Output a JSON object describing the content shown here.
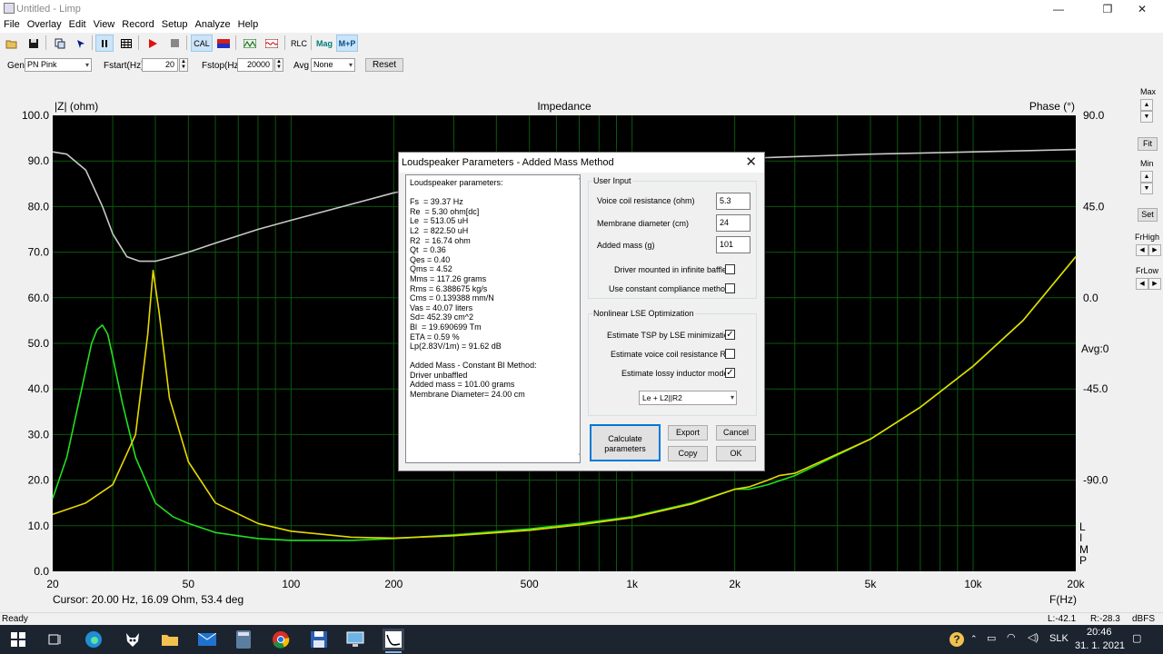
{
  "window": {
    "title": "Untitled - Limp",
    "controls": [
      "—",
      "❐",
      "✕"
    ]
  },
  "menu": [
    "File",
    "Overlay",
    "Edit",
    "View",
    "Record",
    "Setup",
    "Analyze",
    "Help"
  ],
  "toolbar": {
    "cal_label": "CAL",
    "rlc_label": "RLC",
    "mag_label": "Mag",
    "mp_label": "M+P"
  },
  "genbar": {
    "gen_label": "Gen",
    "gen_value": "PN Pink",
    "fstart_label": "Fstart(Hz)",
    "fstart_value": "20",
    "fstop_label": "Fstop(Hz)",
    "fstop_value": "20000",
    "avg_label": "Avg",
    "avg_value": "None",
    "reset_label": "Reset"
  },
  "plot": {
    "title": "Impedance",
    "y_left_label": "|Z| (ohm)",
    "y_right_label": "Phase (°)",
    "x_label": "F(Hz)",
    "cursor_text": "Cursor: 20.00 Hz, 16.09 Ohm, 53.4 deg",
    "avg_text": "Avg:0",
    "limp_letters": [
      "L",
      "I",
      "M",
      "P"
    ]
  },
  "chart_data": {
    "type": "line",
    "title": "Impedance",
    "xlabel": "F(Hz)",
    "ylabel": "|Z| (ohm)",
    "y2label": "Phase (°)",
    "xscale": "log",
    "xlim": [
      20,
      20000
    ],
    "ylim": [
      0,
      100
    ],
    "y2lim": [
      -135,
      90
    ],
    "x_ticks": [
      "20",
      "50",
      "100",
      "200",
      "500",
      "1k",
      "2k",
      "5k",
      "10k",
      "20k"
    ],
    "y_ticks": [
      "100.0",
      "90.0",
      "80.0",
      "70.0",
      "60.0",
      "50.0",
      "40.0",
      "30.0",
      "20.0",
      "10.0",
      "0.0"
    ],
    "y2_ticks": [
      "90.0",
      "45.0",
      "0.0",
      "-45.0",
      "-90.0"
    ],
    "grid": true,
    "background": "#000000",
    "series": [
      {
        "color": "#22e01e",
        "x": [
          20,
          22,
          24,
          26,
          27,
          28,
          29,
          30,
          32,
          35,
          40,
          45,
          50,
          60,
          80,
          100,
          150,
          200,
          300,
          500,
          700,
          1000,
          1500,
          2000,
          2200,
          2500,
          3000,
          5000,
          7000,
          10000,
          14000,
          20000
        ],
        "y": [
          16,
          25,
          38,
          50,
          53,
          54,
          52,
          47,
          37,
          25,
          15,
          12,
          10.5,
          8.5,
          7.2,
          6.8,
          6.8,
          7.2,
          8,
          9.3,
          10.5,
          12,
          15,
          18,
          18,
          19,
          21,
          29,
          36,
          45,
          55,
          69
        ]
      },
      {
        "color": "#e8d800",
        "x": [
          20,
          25,
          30,
          35,
          38,
          39.4,
          41,
          44,
          50,
          60,
          80,
          100,
          150,
          200,
          300,
          500,
          700,
          1000,
          1500,
          2000,
          2200,
          2500,
          2700,
          3000,
          5000,
          7000,
          10000,
          14000,
          20000
        ],
        "y": [
          12.5,
          15,
          19,
          30,
          52,
          66,
          57,
          38,
          24,
          15,
          10.5,
          8.8,
          7.5,
          7.3,
          7.8,
          9,
          10.2,
          11.8,
          14.8,
          18,
          18.5,
          20,
          21,
          21.5,
          29,
          36,
          45,
          55,
          69
        ]
      },
      {
        "color": "#c8c8c8",
        "x": [
          20,
          22,
          25,
          28,
          30,
          33,
          36,
          40,
          45,
          50,
          60,
          80,
          100,
          150,
          200,
          300,
          500,
          1000,
          2000,
          5000,
          10000,
          20000
        ],
        "y": [
          92,
          91.5,
          88,
          80,
          74,
          69,
          68,
          68,
          69,
          70,
          72,
          75,
          77,
          80.5,
          83,
          85.5,
          87.5,
          89.5,
          90.5,
          91.5,
          92,
          92.5
        ]
      }
    ]
  },
  "right_panel": {
    "max_label": "Max",
    "fit_label": "Fit",
    "min_label": "Min",
    "set_label": "Set",
    "frhigh_label": "FrHigh",
    "frlow_label": "FrLow"
  },
  "status": {
    "ready": "Ready",
    "l_value": "L:-42.1",
    "r_value": "R:-28.3",
    "unit": "dBFS"
  },
  "taskbar": {
    "time": "20:46",
    "date": "31. 1. 2021",
    "lang": "SLK"
  },
  "dialog": {
    "title": "Loudspeaker Parameters - Added Mass Method",
    "param_lines": [
      "Loudspeaker parameters:",
      "",
      "Fs  = 39.37 Hz",
      "Re  = 5.30 ohm[dc]",
      "Le  = 513.05 uH",
      "L2  = 822.50 uH",
      "R2  = 16.74 ohm",
      "Qt  = 0.36",
      "Qes = 0.40",
      "Qms = 4.52",
      "Mms = 117.26 grams",
      "Rms = 6.388675 kg/s",
      "Cms = 0.139388 mm/N",
      "Vas = 40.07 liters",
      "Sd= 452.39 cm^2",
      "Bl  = 19.690699 Tm",
      "ETA = 0.59 %",
      "Lp(2.83V/1m) = 91.62 dB",
      "",
      "Added Mass - Constant Bl Method:",
      "Driver unbaffled",
      "Added mass = 101.00 grams",
      "Membrane Diameter= 24.00 cm"
    ],
    "user_input_title": "User Input",
    "vc_label": "Voice coil resistance (ohm)",
    "vc_value": "5.3",
    "md_label": "Membrane diameter (cm)",
    "md_value": "24",
    "am_label": "Added mass (g)",
    "am_value": "101",
    "baffle_label": "Driver mounted in infinite baffle",
    "baffle_checked": false,
    "constcomp_label": "Use constant compliance method",
    "constcomp_checked": false,
    "nonlinear_title": "Nonlinear LSE Optimization",
    "est_tsp_label": "Estimate TSP by LSE minimization",
    "est_tsp_checked": true,
    "est_re_label": "Estimate voice coil resistance Re",
    "est_re_checked": false,
    "est_ind_label": "Estimate lossy inductor model",
    "est_ind_checked": true,
    "model_value": "Le + L2||R2",
    "calc_label": "Calculate parameters",
    "export_label": "Export",
    "cancel_label": "Cancel",
    "copy_label": "Copy",
    "ok_label": "OK"
  }
}
